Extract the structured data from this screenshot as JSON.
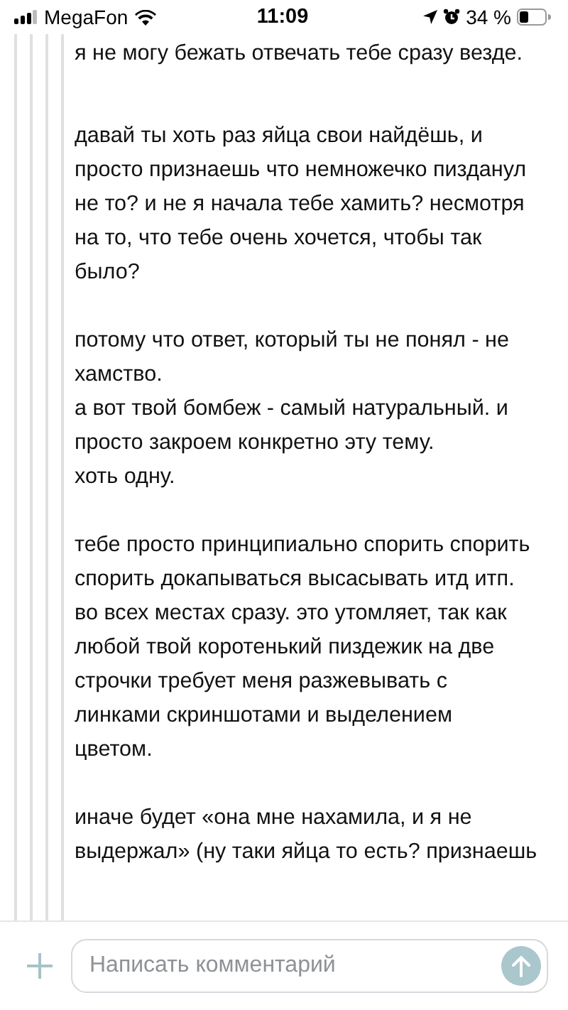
{
  "status_bar": {
    "carrier": "MegaFon",
    "time": "11:09",
    "battery": "34 %"
  },
  "comment": {
    "paragraphs": [
      [
        "я не могу бежать отвечать тебе сразу везде."
      ],
      [
        "давай ты хоть раз яйца свои найдёшь, и",
        "просто признаешь что немножечко пизданул",
        "не то? и не я начала тебе хамить? несмотря",
        "на то, что тебе очень хочется, чтобы так",
        "было?"
      ],
      [
        "потому что ответ, который ты не понял - не",
        "хамство.",
        "а вот твой бомбеж - самый натуральный. и",
        "просто закроем конкретно эту тему.",
        "хоть одну."
      ],
      [
        "тебе просто принципиально спорить спорить",
        "спорить докапываться высасывать итд итп.",
        "во всех местах сразу. это утомляет, так как",
        "любой твой коротенький пиздежик на две",
        "строчки требует меня разжевывать с",
        "линками скриншотами и выделением",
        "цветом."
      ],
      [
        "иначе будет «она мне нахамила, и я не",
        "выдержал» (ну таки яйца то есть? признаешь"
      ]
    ]
  },
  "composer": {
    "placeholder": "Написать комментарий"
  }
}
